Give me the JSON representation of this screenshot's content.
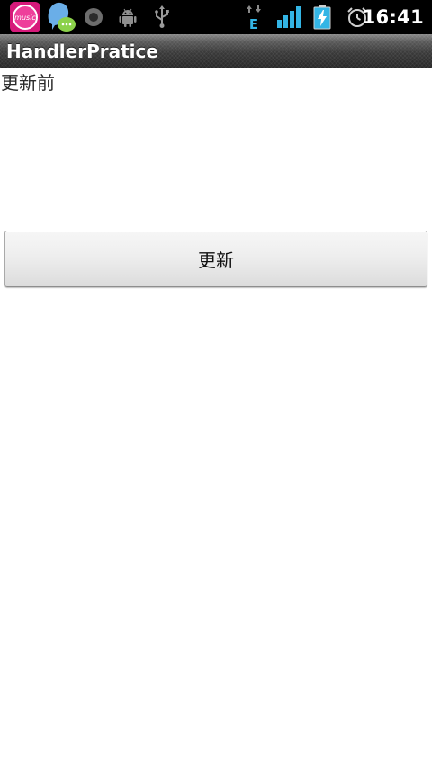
{
  "status_bar": {
    "time": "16:41",
    "music_app_label": "music",
    "network_type": "E",
    "icons": [
      "music-app-icon",
      "chat-bubble-icon",
      "record-icon",
      "android-debug-icon",
      "usb-icon",
      "mobile-data-icon",
      "signal-strength-icon",
      "battery-charging-icon",
      "alarm-icon"
    ],
    "accent_color": "#33b5e5"
  },
  "title_bar": {
    "title": "HandlerPratice"
  },
  "main": {
    "status_text": "更新前",
    "update_button_label": "更新"
  }
}
